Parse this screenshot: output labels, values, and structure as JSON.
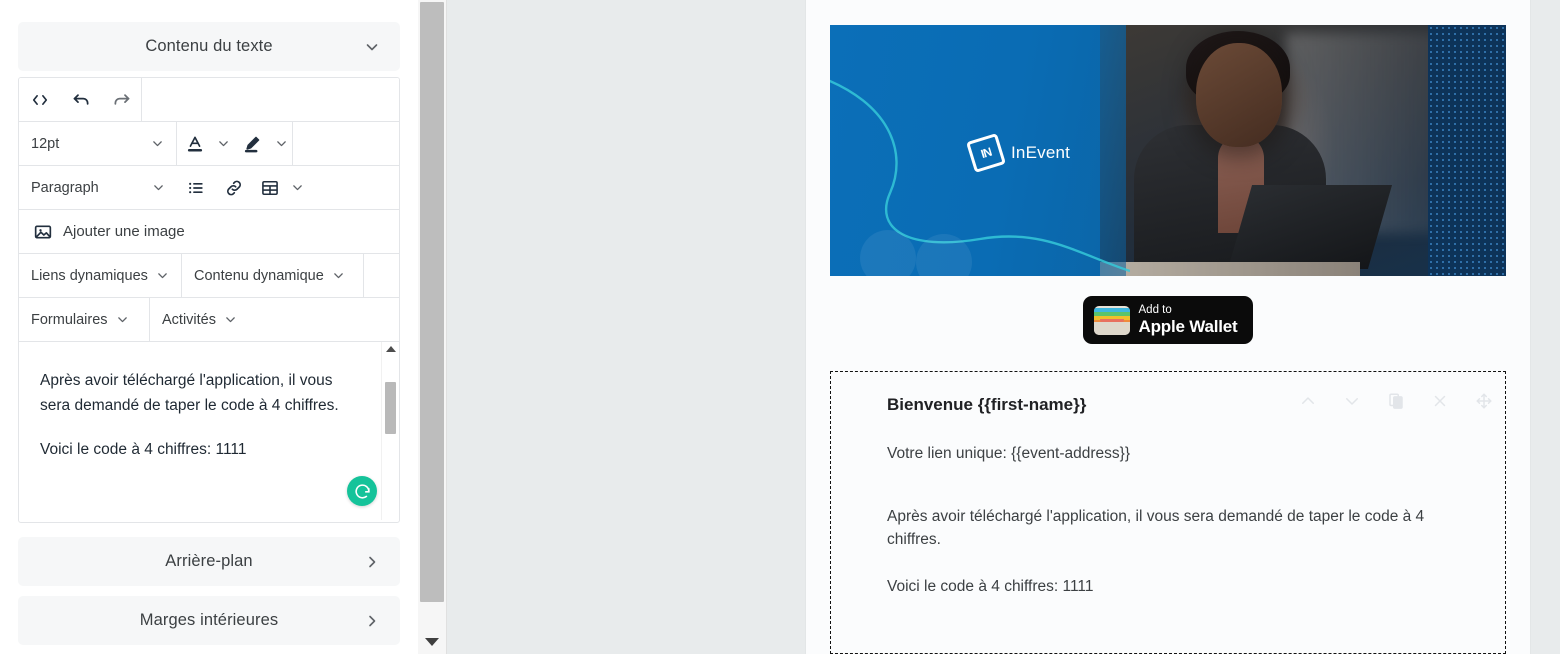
{
  "editor_panel": {
    "sections": [
      {
        "id": "text-content",
        "label": "Contenu du texte",
        "chevron": "chevron-down-icon"
      },
      {
        "id": "background",
        "label": "Arrière-plan",
        "chevron": "chevron-right-icon"
      },
      {
        "id": "padding",
        "label": "Marges intérieures",
        "chevron": "chevron-right-icon"
      }
    ],
    "toolbar": {
      "row1": [
        {
          "name": "source-code-icon",
          "label": "<>"
        },
        {
          "name": "undo-icon",
          "label": ""
        },
        {
          "name": "redo-icon",
          "label": ""
        }
      ],
      "font_size": "12pt",
      "text_color_icon": "text-color-icon",
      "highlight_color_icon": "highlight-color-icon",
      "block_format": "Paragraph",
      "bullet_list_icon": "bullet-list-icon",
      "link_icon": "link-icon",
      "table_icon": "table-icon",
      "add_image_label": "Ajouter une image",
      "add_image_icon": "image-icon",
      "dropdowns": [
        {
          "name": "dynamic-links",
          "label": "Liens dynamiques"
        },
        {
          "name": "dynamic-content",
          "label": "Contenu dynamique"
        },
        {
          "name": "forms",
          "label": "Formulaires"
        },
        {
          "name": "activities",
          "label": "Activités"
        }
      ]
    },
    "content": {
      "paragraphs": [
        "Après avoir téléchargé l'application, il vous sera demandé de taper le code à 4 chiffres.",
        "Voici le code à 4 chiffres: 1111"
      ],
      "grammarly_badge": "grammarly-icon",
      "grammarly_color": "#15c39a"
    }
  },
  "email_preview": {
    "banner": {
      "logo_mark": "inevent-logo-icon",
      "logo_mark_text": "IN",
      "brand_name": "InEvent",
      "brand_blue": "#0a6cb4"
    },
    "wallet_button": {
      "icon": "apple-wallet-icon",
      "line1": "Add to",
      "line2": "Apple Wallet"
    },
    "selected_block": {
      "toolbar_icons": [
        "chevron-up-icon",
        "chevron-down-icon",
        "duplicate-icon",
        "close-icon",
        "move-icon"
      ],
      "title": "Bienvenue {{first-name}}",
      "paragraphs": [
        "Votre lien unique: {{event-address}}",
        "Après avoir téléchargé l'application, il vous sera demandé de taper le code à 4 chiffres.",
        "Voici le code à 4 chiffres: 1111"
      ]
    }
  }
}
